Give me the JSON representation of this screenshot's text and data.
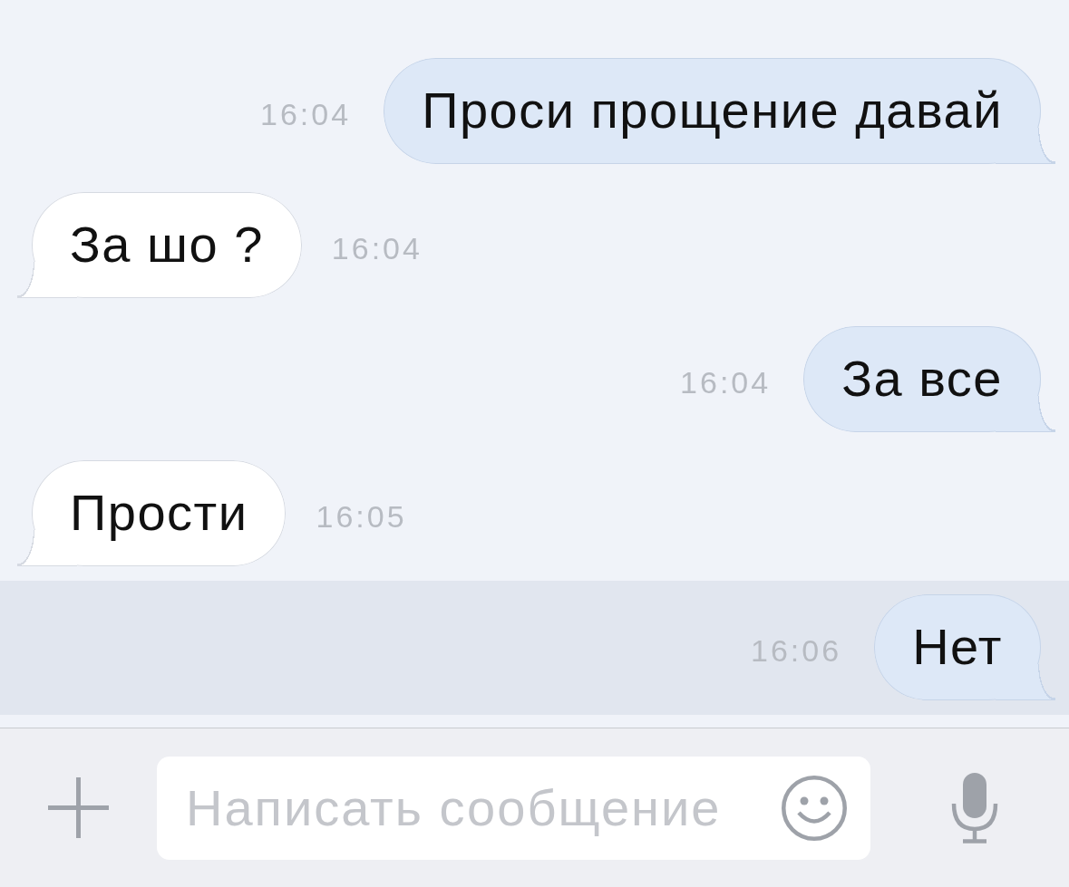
{
  "messages": [
    {
      "kind": "outgoing",
      "text": "Проси прощение давай",
      "time": "16:04",
      "unread": false
    },
    {
      "kind": "incoming",
      "text": "За шо ?",
      "time": "16:04",
      "unread": false
    },
    {
      "kind": "outgoing",
      "text": "За все",
      "time": "16:04",
      "unread": false
    },
    {
      "kind": "incoming",
      "text": "Прости",
      "time": "16:05",
      "unread": false
    },
    {
      "kind": "outgoing",
      "text": "Нет",
      "time": "16:06",
      "unread": true
    }
  ],
  "composer": {
    "placeholder": "Написать сообщение"
  }
}
